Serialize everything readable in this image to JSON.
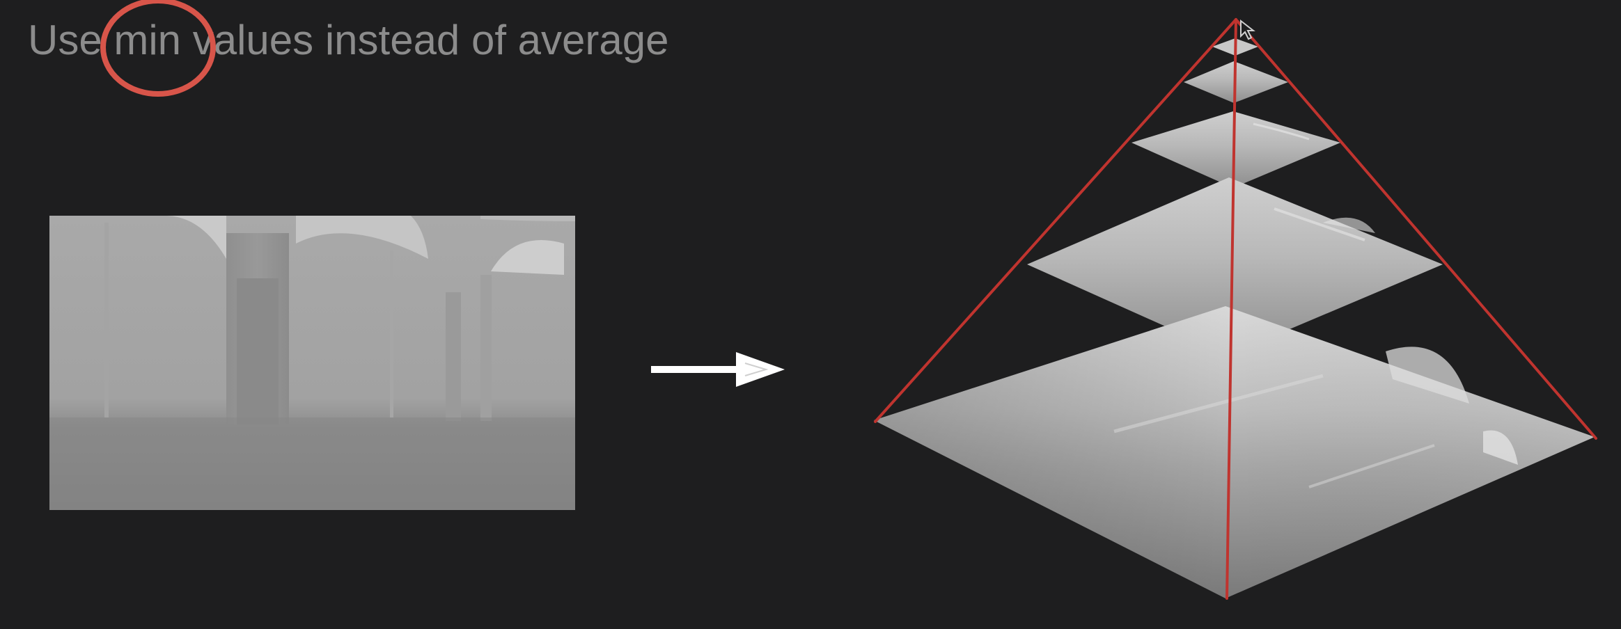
{
  "slide": {
    "title": "Use min values instead of average",
    "highlighted_word": "min",
    "background_color": "#1e1e1f",
    "title_color": "#8c8c8c",
    "highlight_color": "#d8554a",
    "pyramid_edge_color": "#c0342f",
    "arrow_color": "#ffffff"
  },
  "diagram": {
    "pyramid_level_count": 5
  }
}
